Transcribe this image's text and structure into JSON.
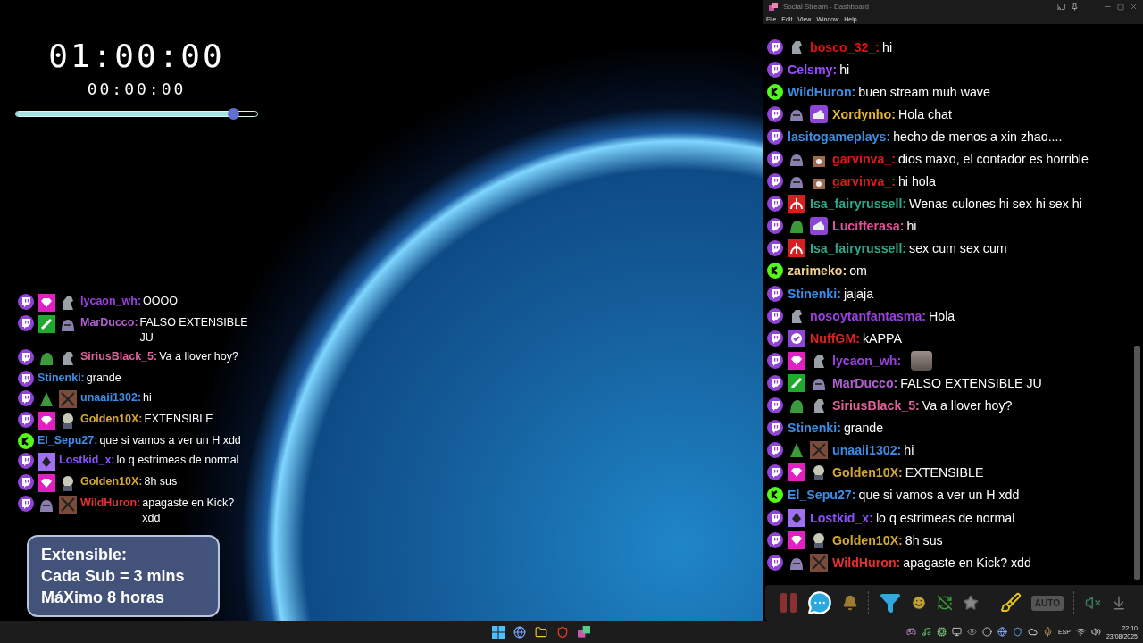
{
  "timer": {
    "main": "01:00:00",
    "elapsed": "00:00:00",
    "progress": {
      "level": 0.9
    }
  },
  "overlay_chat": {
    "messages": [
      {
        "kind": "twitch",
        "badges": [
          {
            "kind": "gem"
          },
          {
            "kind": "knight"
          }
        ],
        "name": "lycaon_wh:",
        "color": "#9a40e0",
        "text": "OOOO"
      },
      {
        "kind": "twitch",
        "badges": [
          {
            "kind": "sword"
          },
          {
            "kind": "blob"
          }
        ],
        "name": "MarDucco:",
        "color": "#b060d0",
        "text": "FALSO EXTENSIBLE JU"
      },
      {
        "kind": "twitch",
        "badges": [
          {
            "kind": "frog"
          },
          {
            "kind": "knight"
          }
        ],
        "name": "SiriusBlack_5:",
        "color": "#e0609a",
        "text": "Va a llover hoy?"
      },
      {
        "kind": "twitch",
        "name": "Stinenki:",
        "color": "#3a8ee8",
        "text": "grande"
      },
      {
        "kind": "twitch",
        "badges": [
          {
            "kind": "tree"
          },
          {
            "kind": "cross"
          }
        ],
        "name": "unaaii1302:",
        "color": "#3a8ee8",
        "text": "hi"
      },
      {
        "kind": "twitch",
        "badges": [
          {
            "kind": "gem"
          },
          {
            "kind": "skull"
          }
        ],
        "name": "Golden10X:",
        "color": "#d4a830",
        "text": "EXTENSIBLE"
      },
      {
        "kind": "kick",
        "name": "El_Sepu27:",
        "color": "#3a8ee8",
        "text": "que si vamos a ver un H xdd"
      },
      {
        "kind": "twitch",
        "badges": [
          {
            "kind": "diamond"
          }
        ],
        "name": "Lostkid_x:",
        "color": "#8a50ff",
        "text": "lo q estrimeas de normal"
      },
      {
        "kind": "twitch",
        "badges": [
          {
            "kind": "gem"
          },
          {
            "kind": "skull"
          }
        ],
        "name": "Golden10X:",
        "color": "#d4a830",
        "text": "8h sus"
      },
      {
        "kind": "twitch",
        "badges": [
          {
            "kind": "blob"
          },
          {
            "kind": "cross"
          }
        ],
        "name": "WildHuron:",
        "color": "#e03030",
        "text": "apagaste en Kick? xdd"
      }
    ]
  },
  "info_box": {
    "lines": [
      "Extensible:",
      "Cada Sub = 3 mins",
      "MáXimo 8 horas"
    ]
  },
  "window": {
    "title": "Social Stream - Dashboard",
    "menu": [
      "File",
      "Edit",
      "View",
      "Window",
      "Help"
    ]
  },
  "chat": {
    "messages": [
      {
        "kind": "twitch",
        "badges": [
          {
            "kind": "knight"
          }
        ],
        "name": "bosco_32_:",
        "color": "#e01010",
        "text": "hi"
      },
      {
        "kind": "twitch",
        "name": "Celsmy:",
        "color": "#9a4dff",
        "text": "hi"
      },
      {
        "kind": "kick",
        "name": "WildHuron:",
        "color": "#3a8ee8",
        "text": "buen stream muh wave"
      },
      {
        "kind": "twitch",
        "badges": [
          {
            "kind": "blob"
          },
          {
            "kind": "cake"
          }
        ],
        "name": "Xordynho:",
        "color": "#e8b830",
        "text": "Hola chat"
      },
      {
        "kind": "twitch",
        "name": "lasitogameplays:",
        "color": "#3a8ee8",
        "text": "hecho de menos a xin zhao...."
      },
      {
        "kind": "twitch",
        "badges": [
          {
            "kind": "blob"
          },
          {
            "kind": "tally"
          }
        ],
        "name": "garvinva_:",
        "color": "#e01818",
        "text": "dios maxo, el contador es horrible"
      },
      {
        "kind": "twitch",
        "badges": [
          {
            "kind": "blob"
          },
          {
            "kind": "tally"
          }
        ],
        "name": "garvinva_:",
        "color": "#e01818",
        "text": "hi hola"
      },
      {
        "kind": "twitch",
        "badges": [
          {
            "kind": "rune"
          }
        ],
        "name": "Isa_fairyrussell:",
        "color": "#2fa88a",
        "text": "Wenas culones hi sex hi sex hi"
      },
      {
        "kind": "twitch",
        "badges": [
          {
            "kind": "frog"
          },
          {
            "kind": "cake"
          }
        ],
        "name": "Lucifferasa:",
        "color": "#e0509a",
        "text": "hi"
      },
      {
        "kind": "twitch",
        "badges": [
          {
            "kind": "rune"
          }
        ],
        "name": "Isa_fairyrussell:",
        "color": "#2fa88a",
        "text": "sex cum sex cum"
      },
      {
        "kind": "kick",
        "name": "zarimeko:",
        "color": "#f0d090",
        "text": "om"
      },
      {
        "kind": "twitch",
        "name": "Stinenki:",
        "color": "#3a8ee8",
        "text": "jajaja"
      },
      {
        "kind": "twitch",
        "badges": [
          {
            "kind": "knight"
          }
        ],
        "name": "nosoytanfantasma:",
        "color": "#9a40e0",
        "text": "Hola"
      },
      {
        "kind": "twitch",
        "badges": [
          {
            "kind": "check"
          }
        ],
        "name": "NuffGM:",
        "color": "#e02020",
        "text": "kAPPA"
      },
      {
        "kind": "twitch",
        "badges": [
          {
            "kind": "gem"
          },
          {
            "kind": "knight"
          }
        ],
        "name": "lycaon_wh:",
        "color": "#9a40e0",
        "emote": true
      },
      {
        "kind": "twitch",
        "badges": [
          {
            "kind": "sword"
          },
          {
            "kind": "blob"
          }
        ],
        "name": "MarDucco:",
        "color": "#b060d0",
        "text": "FALSO EXTENSIBLE JU"
      },
      {
        "kind": "twitch",
        "badges": [
          {
            "kind": "frog"
          },
          {
            "kind": "knight"
          }
        ],
        "name": "SiriusBlack_5:",
        "color": "#e0609a",
        "text": "Va a llover hoy?"
      },
      {
        "kind": "twitch",
        "name": "Stinenki:",
        "color": "#3a8ee8",
        "text": "grande"
      },
      {
        "kind": "twitch",
        "badges": [
          {
            "kind": "tree"
          },
          {
            "kind": "cross"
          }
        ],
        "name": "unaaii1302:",
        "color": "#3a8ee8",
        "text": "hi"
      },
      {
        "kind": "twitch",
        "badges": [
          {
            "kind": "gem"
          },
          {
            "kind": "skull"
          }
        ],
        "name": "Golden10X:",
        "color": "#d4a830",
        "text": "EXTENSIBLE"
      },
      {
        "kind": "kick",
        "name": "El_Sepu27:",
        "color": "#3a8ee8",
        "text": "que si vamos a ver un H xdd"
      },
      {
        "kind": "twitch",
        "badges": [
          {
            "kind": "diamond"
          }
        ],
        "name": "Lostkid_x:",
        "color": "#8a50ff",
        "text": "lo q estrimeas de normal"
      },
      {
        "kind": "twitch",
        "badges": [
          {
            "kind": "gem"
          },
          {
            "kind": "skull"
          }
        ],
        "name": "Golden10X:",
        "color": "#d4a830",
        "text": "8h sus"
      },
      {
        "kind": "twitch",
        "badges": [
          {
            "kind": "blob"
          },
          {
            "kind": "cross"
          }
        ],
        "name": "WildHuron:",
        "color": "#e03030",
        "text": "apagaste en Kick? xdd"
      }
    ]
  },
  "toolbar": {
    "auto_label": "AUTO"
  },
  "taskbar": {
    "language": "ESP",
    "time": "22:10",
    "date": "23/08/2025"
  }
}
